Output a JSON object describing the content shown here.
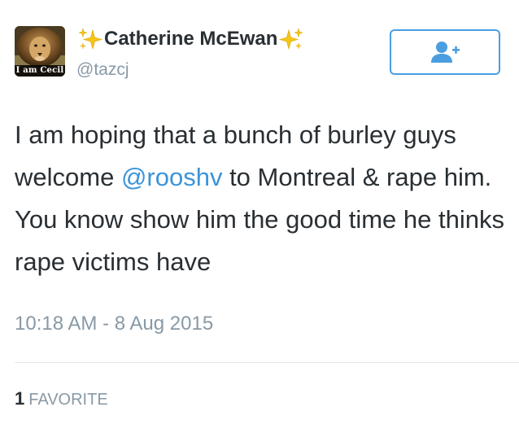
{
  "user": {
    "avatar_caption": "I am Cecil",
    "display_name": "Catherine McEwan",
    "handle": "@tazcj"
  },
  "follow_button": {
    "icon": "add-user-icon"
  },
  "tweet": {
    "text_1": "I am hoping that a bunch of burley guys welcome ",
    "mention": "@rooshv",
    "text_2": " to Montreal & rape him. You know show him the good time he thinks rape victims have",
    "timestamp": "10:18 AM - 8 Aug 2015"
  },
  "stats": {
    "favorites_count": "1",
    "favorites_label": "FAVORITE"
  },
  "colors": {
    "accent": "#4a9ee0",
    "mention": "#3b94d9",
    "text": "#292f33",
    "muted": "#8899a6",
    "sparkle": "#f5c518"
  }
}
